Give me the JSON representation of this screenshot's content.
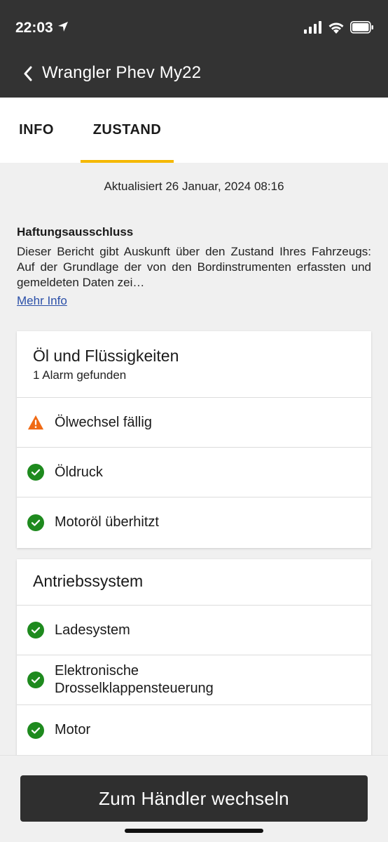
{
  "status": {
    "time": "22:03",
    "icons": [
      "location-arrow-icon",
      "signal-icon",
      "wifi-icon",
      "battery-icon"
    ]
  },
  "header": {
    "title": "Wrangler Phev My22",
    "back_icon": "chevron-left-icon"
  },
  "tabs": [
    {
      "label": "INFO",
      "active": false
    },
    {
      "label": "ZUSTAND",
      "active": true
    }
  ],
  "updated": "Aktualisiert 26 Januar, 2024 08:16",
  "disclaimer": {
    "title": "Haftungsausschluss",
    "text": "Dieser Bericht gibt Auskunft über den Zustand Ihres Fahrzeugs: Auf der Grundlage der von den Bordinstrumenten erfassten und gemeldeten Daten zei…",
    "more_link": "Mehr Info"
  },
  "sections": [
    {
      "title": "Öl und Flüssigkeiten",
      "subtitle": "1 Alarm gefunden",
      "items": [
        {
          "label": "Ölwechsel fällig",
          "status": "warning"
        },
        {
          "label": "Öldruck",
          "status": "ok"
        },
        {
          "label": "Motoröl überhitzt",
          "status": "ok"
        }
      ]
    },
    {
      "title": "Antriebssystem",
      "items": [
        {
          "label": "Ladesystem",
          "status": "ok"
        },
        {
          "label": "Elektronische Drosselklappensteuerung",
          "status": "ok"
        },
        {
          "label": "Motor",
          "status": "ok"
        }
      ]
    }
  ],
  "action_button": "Zum Händler wechseln",
  "colors": {
    "header_bg": "#333333",
    "tab_accent": "#f5b800",
    "ok_green": "#1e8a1e",
    "warning_orange": "#f06a14",
    "link_blue": "#2a4fa8",
    "button_bg": "#2f2f2f"
  }
}
